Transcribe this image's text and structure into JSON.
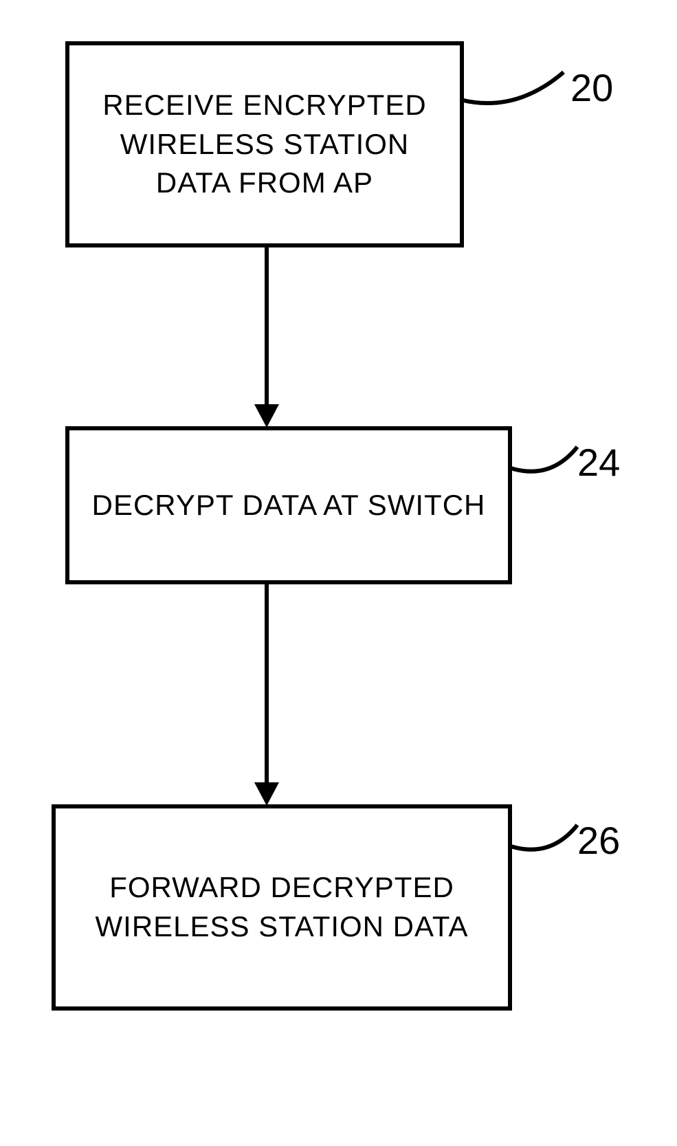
{
  "boxes": {
    "step1": {
      "text": "RECEIVE ENCRYPTED WIRELESS STATION DATA FROM AP",
      "ref": "20"
    },
    "step2": {
      "text": "DECRYPT DATA AT SWITCH",
      "ref": "24"
    },
    "step3": {
      "text": "FORWARD DECRYPTED WIRELESS STATION DATA",
      "ref": "26"
    }
  }
}
